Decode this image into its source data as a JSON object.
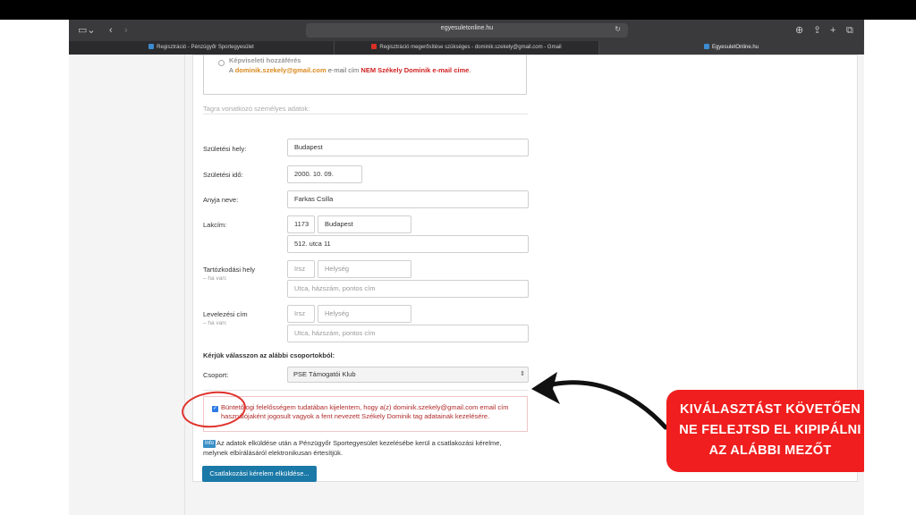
{
  "browser": {
    "url": "egyesuletonline.hu",
    "tabs": [
      {
        "label": "Regisztráció - Pénzügyőr Sportegyesület",
        "favicon": "site-icon"
      },
      {
        "label": "Regisztráció megerősítése szükséges - dominik.szekely@gmail.com - Gmail",
        "favicon": "gmail-icon"
      },
      {
        "label": "EgyesuletOnline.hu",
        "favicon": "site-icon"
      }
    ]
  },
  "representation": {
    "title": "Képviseleti hozzáférés",
    "prefix": "A",
    "email": "dominik.szekely@gmail.com",
    "middle": "e-mail cím",
    "warning": "NEM Székely Dominik e-mail címe",
    "suffix": "."
  },
  "section": {
    "title": "Tagra vonatkozó személyes adatok:"
  },
  "fields": {
    "birthplace": {
      "label": "Születési hely:",
      "value": "Budapest"
    },
    "birthdate": {
      "label": "Születési idő:",
      "value": "2000. 10. 09."
    },
    "mother": {
      "label": "Anyja neve:",
      "value": "Farkas Csilla"
    },
    "address": {
      "label": "Lakcím:",
      "zip": "1173",
      "city": "Budapest",
      "street": "512. utca 11"
    },
    "stay": {
      "label": "Tartózkodási hely",
      "sub": "– ha van:",
      "zip_ph": "Irsz",
      "city_ph": "Helység",
      "street_ph": "Utca, házszám, pontos cím"
    },
    "mail": {
      "label": "Levelezési cím",
      "sub": "– ha van:",
      "zip_ph": "Irsz",
      "city_ph": "Helység",
      "street_ph": "Utca, házszám, pontos cím"
    }
  },
  "group": {
    "prompt": "Kérjük válasszon az alábbi csoportokból:",
    "label": "Csoport:",
    "selected": "PSE Támogatói Klub"
  },
  "consent": {
    "checked": true,
    "text": "Büntetőjogi felelősségem tudatában kijelentem, hogy a(z) dominik.szekely@gmail.com email cím használójaként jogosult vagyok a fent nevezett Székely Dominik tag adatainak kezelésére."
  },
  "info": {
    "badge": "Info",
    "line1": "Az adatok elküldése után a Pénzügyőr Sportegyesület kezelésébe kerül a csatlakozási kérelme,",
    "line2": "melynek elbírálásáról elektronikusan értesítjük."
  },
  "submit_label": "Csatlakozási kérelem elküldése...",
  "callout": {
    "lines": [
      "KIVÁLASZTÁST KÖVETŐEN",
      "NE FELEJTSD EL KIPIPÁLNI",
      "AZ ALÁBBI MEZŐT"
    ],
    "color": "#f01e1e"
  }
}
